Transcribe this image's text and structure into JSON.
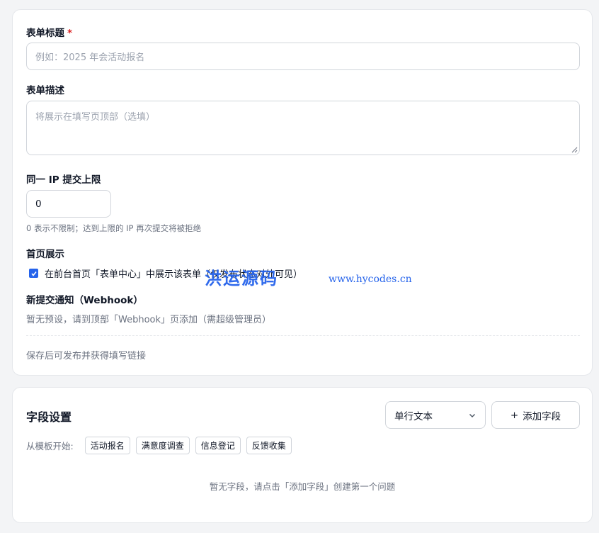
{
  "form": {
    "title_label": "表单标题",
    "required_mark": "*",
    "title_placeholder": "例如：2025 年会活动报名",
    "desc_label": "表单描述",
    "desc_placeholder": "将展示在填写页顶部（选填）",
    "ip_label": "同一 IP 提交上限",
    "ip_value": "0",
    "ip_hint": "0 表示不限制；达到上限的 IP 再次提交将被拒绝",
    "home_label": "首页展示",
    "home_checkbox_label": "在前台首页「表单中心」中展示该表单（仅发布状态对外可见）",
    "home_checked": true,
    "webhook_label": "新提交通知（Webhook）",
    "webhook_text": "暂无预设，请到顶部「Webhook」页添加（需超级管理员）",
    "save_hint": "保存后可发布并获得填写链接"
  },
  "watermark": {
    "text": "洪运源码",
    "url": "www.hycodes.cn"
  },
  "fields": {
    "title": "字段设置",
    "type_select_value": "单行文本",
    "add_button_label": "添加字段",
    "template_label": "从模板开始:",
    "templates": [
      "活动报名",
      "满意度调查",
      "信息登记",
      "反馈收集"
    ],
    "empty_text": "暂无字段，请点击「添加字段」创建第一个问题"
  },
  "colors": {
    "accent": "#2563eb",
    "required": "#dc2626"
  }
}
